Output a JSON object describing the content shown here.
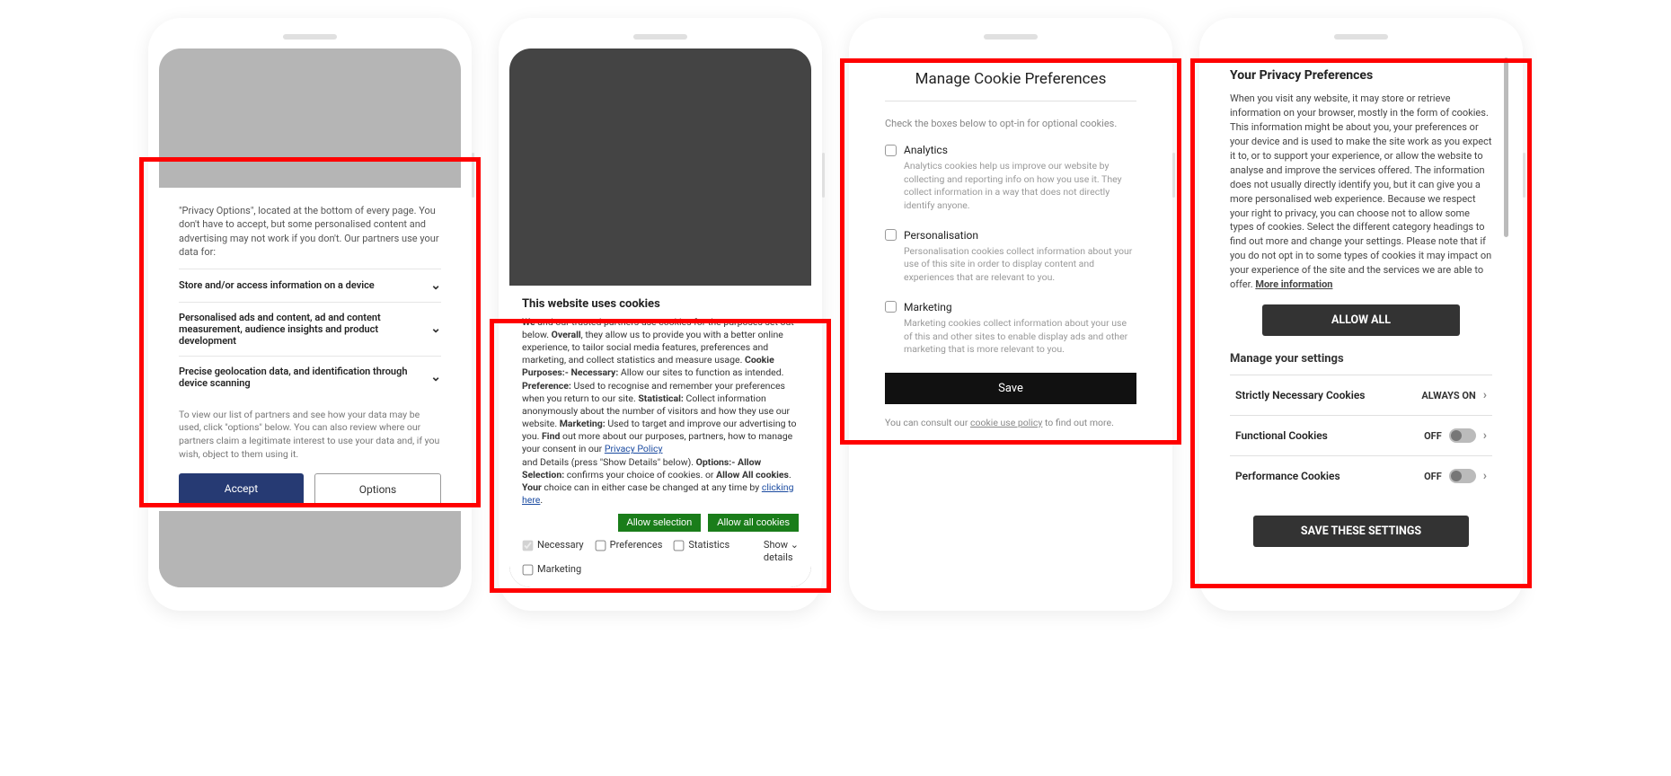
{
  "phone1": {
    "intro": "\"Privacy Options\", located at the bottom of every page. You don't have to accept, but some personalised content and advertising may not work if you don't. Our partners use your data for:",
    "rows": [
      "Store and/or access information on a device",
      "Personalised ads and content, ad and content measurement, audience insights and product development",
      "Precise geolocation data, and identification through device scanning"
    ],
    "note": "To view our list of partners and see how your data may be used, click \"options\" below. You can also review where our partners claim a legitimate interest to use your data and, if you wish, object to them using it.",
    "accept": "Accept",
    "options": "Options"
  },
  "phone2": {
    "title": "This website uses cookies",
    "b_we": "We",
    "t1": " and our trusted partners use cookies for the purposes set out below. ",
    "b_overall": "Overall",
    "t2": ", they allow us to provide you with a better online experience, to tailor social media features, preferences and marketing, and collect statistics and measure usage. ",
    "b_cookiep": "Cookie Purposes:- Necessary:",
    "t3": " Allow our sites to function as intended. ",
    "b_pref": "Preference:",
    "t4": " Used to recognise and remember your preferences when you return to our site. ",
    "b_stat": "Statistical:",
    "t5": " Collect information anonymously about the number of visitors and how they use our website. ",
    "b_mkt": "Marketing:",
    "t6": " Used to target and improve our advertising to you. ",
    "b_find": "Find",
    "t7": " out more about our purposes, partners, how to manage your consent in our ",
    "privacy_link": "Privacy Policy",
    "t8": " and Details (press \"Show Details\" below). ",
    "b_opt": "Options:- Allow Selection:",
    "t9": " confirms your choice of cookies. or ",
    "b_allowall": "Allow All cookies",
    "t10": ". ",
    "b_your": "Your",
    "t11": " choice can in either case be changed at any time by ",
    "click_link": "clicking here",
    "t12": ".",
    "allow_selection": "Allow selection",
    "allow_all": "Allow all cookies",
    "checks": {
      "necessary": "Necessary",
      "preferences": "Preferences",
      "statistics": "Statistics",
      "marketing": "Marketing"
    },
    "show": "Show",
    "details": "details"
  },
  "phone3": {
    "title": "Manage Cookie Preferences",
    "sub": "Check the boxes below to opt-in for optional cookies.",
    "cats": [
      {
        "name": "Analytics",
        "desc": "Analytics cookies help us improve our website by collecting and reporting info on how you use it. They collect information in a way that does not directly identify anyone."
      },
      {
        "name": "Personalisation",
        "desc": "Personalisation cookies collect information about your use of this site in order to display content and experiences that are relevant to you."
      },
      {
        "name": "Marketing",
        "desc": "Marketing cookies collect information about your use of this and other sites to enable display ads and other marketing that is more relevant to you."
      }
    ],
    "save": "Save",
    "footer_pre": "You can consult our ",
    "footer_link": "cookie use policy",
    "footer_post": " to find out more."
  },
  "phone4": {
    "title": "Your Privacy Preferences",
    "intro_pre": "When you visit any website, it may store or retrieve information on your browser, mostly in the form of cookies. This information might be about you, your preferences or your device and is used to make the site work as you expect it to, or to support your experience, or allow the website to analyse and improve the services offered. The information does not usually directly identify you, but it can give you a more personalised web experience. Because we respect your right to privacy, you can choose not to allow some types of cookies. Select the different category headings to find out more and change your settings. Please note that if you do not opt in to some types of cookies it may impact on your experience of the site and the services we are able to offer.  ",
    "more_info": "More information",
    "allow_all": "ALLOW ALL",
    "manage": "Manage your settings",
    "settings": [
      {
        "name": "Strictly Necessary Cookies",
        "state": "ALWAYS ON",
        "toggle": false
      },
      {
        "name": "Functional Cookies",
        "state": "OFF",
        "toggle": true
      },
      {
        "name": "Performance Cookies",
        "state": "OFF",
        "toggle": true
      }
    ],
    "save": "SAVE THESE SETTINGS"
  }
}
